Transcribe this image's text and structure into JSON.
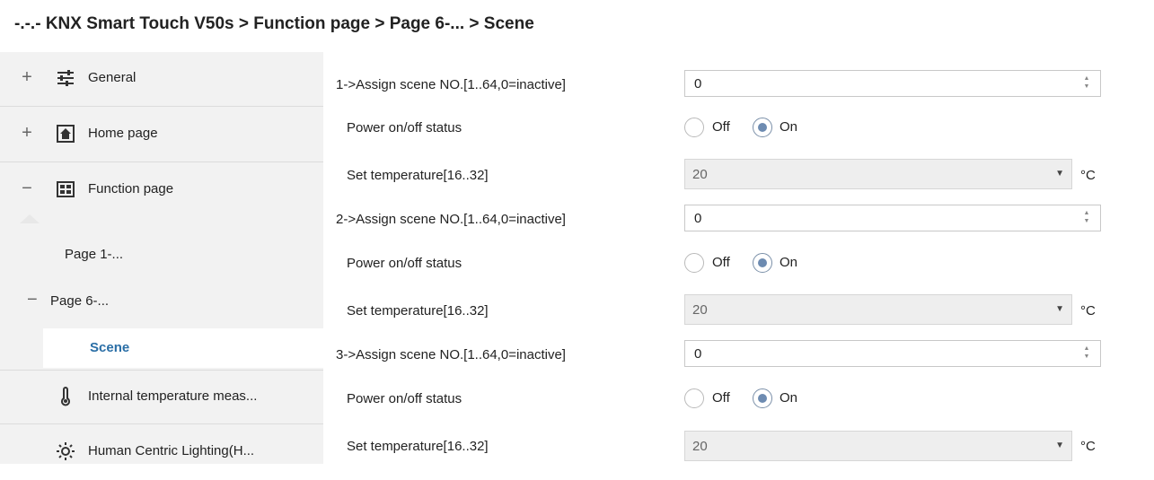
{
  "breadcrumb": "-.-.- KNX Smart Touch V50s > Function page > Page 6-... > Scene",
  "sidebar": {
    "general": {
      "expander": "+",
      "label": "General",
      "icon": "sliders-icon"
    },
    "home": {
      "expander": "+",
      "label": "Home page",
      "icon": "home-icon"
    },
    "function": {
      "expander": "−",
      "label": "Function page",
      "icon": "grid-icon"
    },
    "page1": {
      "label": "Page 1-..."
    },
    "page6": {
      "expander": "−",
      "label": "Page 6-..."
    },
    "scene": {
      "label": "Scene"
    },
    "internal_temp": {
      "label": "Internal temperature meas...",
      "icon": "thermometer-icon"
    },
    "hcl": {
      "label": "Human Centric Lighting(H...",
      "icon": "sun-icon"
    }
  },
  "scenes": [
    {
      "assign_label": "1->Assign scene NO.[1..64,0=inactive]",
      "assign_value": "0",
      "power_label": "Power on/off status",
      "off_label": "Off",
      "on_label": "On",
      "selected": "On",
      "temp_label": "Set temperature[16..32]",
      "temp_value": "20",
      "unit": "°C"
    },
    {
      "assign_label": "2->Assign scene NO.[1..64,0=inactive]",
      "assign_value": "0",
      "power_label": "Power on/off status",
      "off_label": "Off",
      "on_label": "On",
      "selected": "On",
      "temp_label": "Set temperature[16..32]",
      "temp_value": "20",
      "unit": "°C"
    },
    {
      "assign_label": "3->Assign scene NO.[1..64,0=inactive]",
      "assign_value": "0",
      "power_label": "Power on/off status",
      "off_label": "Off",
      "on_label": "On",
      "selected": "On",
      "temp_label": "Set temperature[16..32]",
      "temp_value": "20",
      "unit": "°C"
    }
  ]
}
